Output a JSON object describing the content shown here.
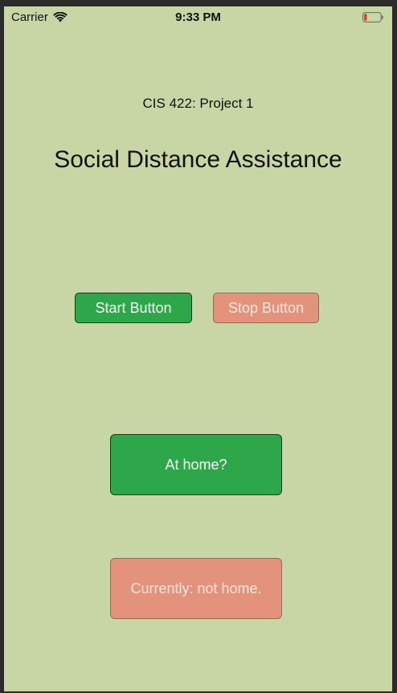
{
  "status_bar": {
    "carrier": "Carrier",
    "time": "9:33 PM",
    "wifi_icon": "wifi-icon",
    "battery_icon": "battery-low-icon"
  },
  "header": {
    "subtitle": "CIS 422: Project 1",
    "title": "Social Distance Assistance"
  },
  "controls": {
    "start_label": "Start Button",
    "stop_label": "Stop Button",
    "home_label": "At home?",
    "status_text": "Currently: not home."
  },
  "colors": {
    "background": "#c8d6a6",
    "active_green": "#2ea64a",
    "inactive_salmon": "#e3937c"
  }
}
